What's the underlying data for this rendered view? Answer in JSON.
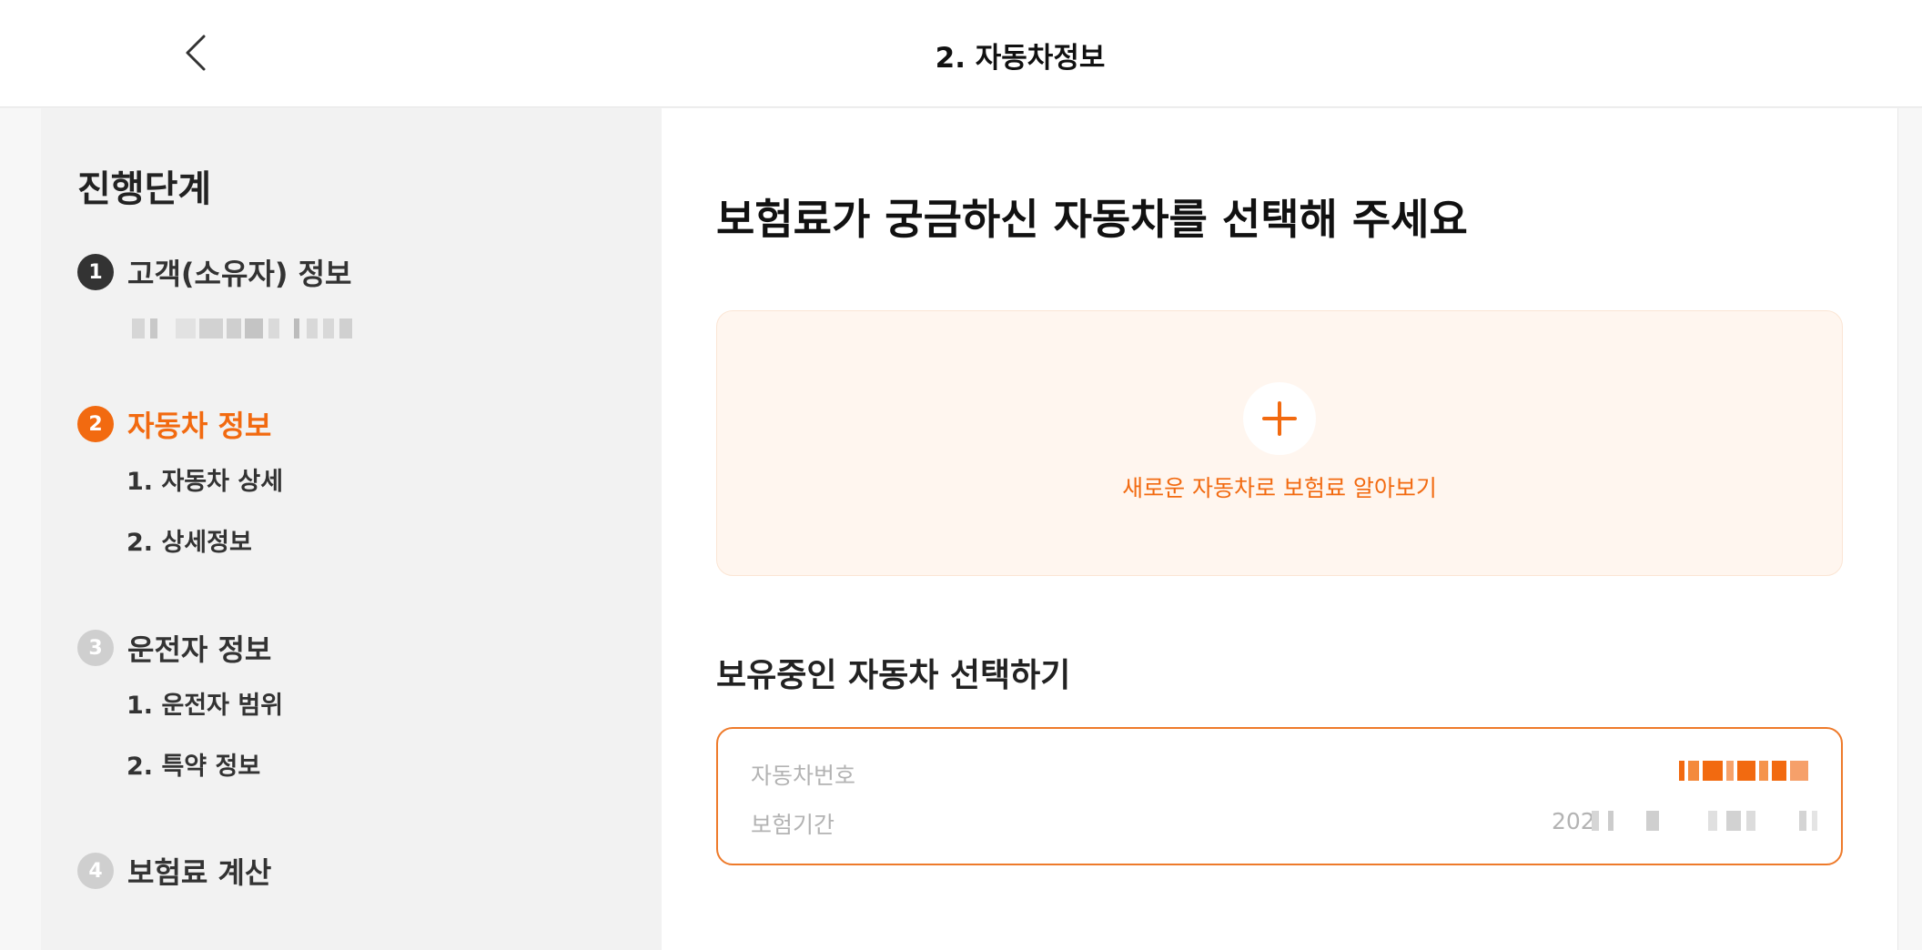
{
  "header": {
    "title": "2. 자동차정보",
    "back_icon": "chevron-left-icon"
  },
  "sidebar": {
    "title": "진행단계",
    "steps": [
      {
        "number": "1",
        "label": "고객(소유자) 정보",
        "state": "done",
        "sub": []
      },
      {
        "number": "2",
        "label": "자동차 정보",
        "state": "active",
        "sub": [
          "1. 자동차 상세",
          "2. 상세정보"
        ]
      },
      {
        "number": "3",
        "label": "운전자 정보",
        "state": "pending",
        "sub": [
          "1. 운전자 범위",
          "2. 특약 정보"
        ]
      },
      {
        "number": "4",
        "label": "보험료 계산",
        "state": "pending",
        "sub": []
      }
    ]
  },
  "main": {
    "title": "보험료가 궁금하신 자동차를 선택해 주세요",
    "new_car": {
      "label": "새로운 자동차로 보험료 알아보기",
      "icon": "plus-icon"
    },
    "owned_title": "보유중인 자동차 선택하기",
    "car": {
      "number_label": "자동차번호",
      "period_label": "보험기간",
      "period_prefix": "202"
    }
  },
  "colors": {
    "accent": "#f26a10",
    "card_bg": "#fff6ef",
    "sidebar_bg": "#f2f2f2",
    "muted_text": "#b3b3b3"
  }
}
